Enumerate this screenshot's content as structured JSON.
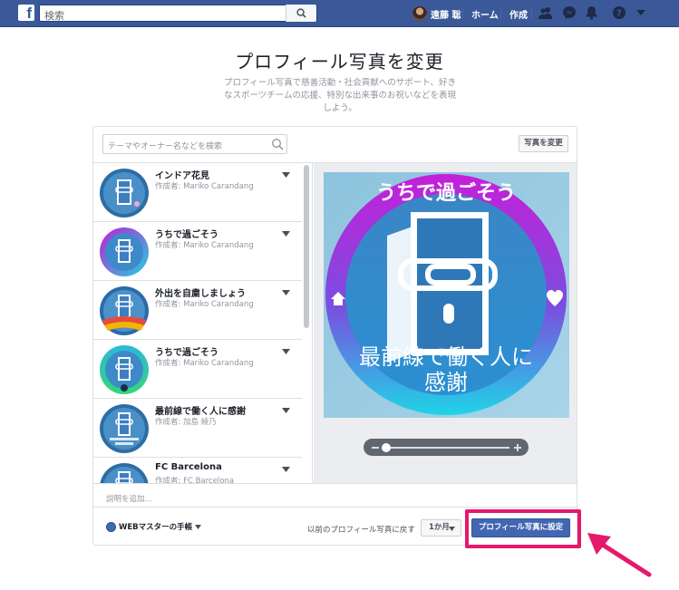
{
  "topbar": {
    "search_placeholder": "検索",
    "user_name": "遠藤 聡",
    "home": "ホーム",
    "create": "作成"
  },
  "header": {
    "title": "プロフィール写真を変更",
    "description": "プロフィール写真で慈善活動・社会貢献へのサポート、好きなスポーツチームの応援、特別な出来事のお祝いなどを表現しよう。"
  },
  "panel": {
    "search_placeholder": "テーマやオーナー名などを検索",
    "change_photo_label": "写真を変更",
    "frames": [
      {
        "title": "インドア花見",
        "author": "作成者: Mariko Carandang"
      },
      {
        "title": "うちで過ごそう",
        "author": "作成者: Mariko Carandang"
      },
      {
        "title": "外出を自粛しましょう",
        "author": "作成者: Mariko Carandang"
      },
      {
        "title": "うちで過ごそう",
        "author": "作成者: Mariko Carandang"
      },
      {
        "title": "最前線で働く人に感謝",
        "author": "作成者: 加島 綾乃"
      },
      {
        "title": "FC Barcelona",
        "author": "作成者: FC Barcelona"
      }
    ],
    "preview": {
      "top_text": "うちで過ごそう",
      "bottom_line1": "最前線で働く人に",
      "bottom_line2": "感謝"
    },
    "add_description": "説明を追加...",
    "page_name": "WEBマスターの手帳",
    "revert_label": "以前のプロフィール写真に戻す",
    "duration": "1か月",
    "set_button": "プロフィール写真に設定"
  },
  "colors": {
    "brand": "#3b5998",
    "primary_button": "#4267b2",
    "highlight": "#e6186c"
  }
}
